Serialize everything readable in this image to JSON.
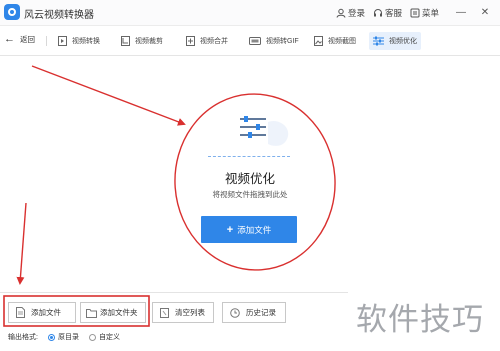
{
  "window": {
    "title": "风云视频转换器",
    "login_label": "登录",
    "service_label": "客服",
    "menu_label": "菜单",
    "minimize_glyph": "—",
    "close_glyph": "✕"
  },
  "toolbar": {
    "back_label": "返回",
    "tabs": [
      {
        "label": "视频转换",
        "icon": "video-convert-icon"
      },
      {
        "label": "视频裁剪",
        "icon": "video-crop-icon"
      },
      {
        "label": "视频合并",
        "icon": "video-merge-icon"
      },
      {
        "label": "视频转GIF",
        "icon": "gif-icon"
      },
      {
        "label": "视频截图",
        "icon": "screenshot-icon"
      },
      {
        "label": "视频优化",
        "icon": "optimize-icon",
        "active": true
      }
    ]
  },
  "drop_area": {
    "title": "视频优化",
    "hint": "将视频文件拖拽到此处",
    "add_button_label": "添加文件"
  },
  "bottom": {
    "add_file_label": "添加文件",
    "add_folder_label": "添加文件夹",
    "clear_list_label": "清空列表",
    "history_label": "历史记录",
    "output_format_label": "输出格式:",
    "options": [
      {
        "label": "原目录",
        "selected": true
      },
      {
        "label": "自定义",
        "selected": false
      }
    ]
  },
  "watermark": "软件技巧",
  "colors": {
    "accent": "#2f86e8",
    "annotation": "#d9302f",
    "watermark": "#a5a8ad"
  }
}
